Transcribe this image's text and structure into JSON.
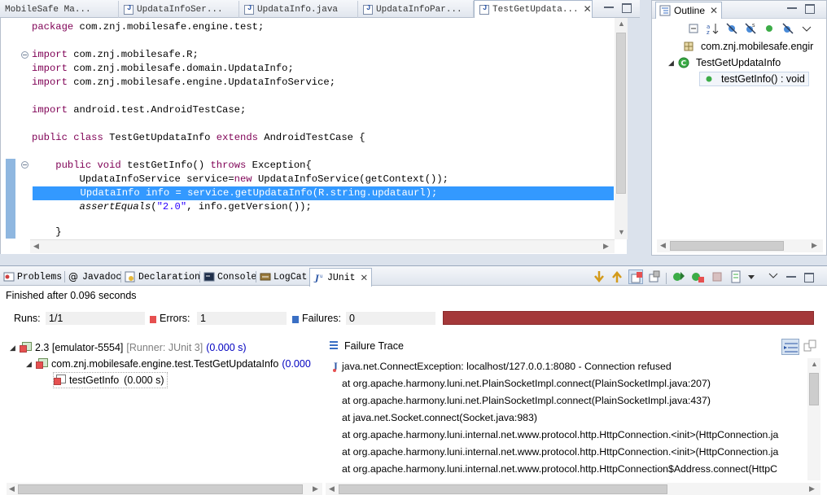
{
  "editor": {
    "tabs": [
      {
        "label": "MobileSafe Ma..."
      },
      {
        "label": "UpdataInfoSer..."
      },
      {
        "label": "UpdataInfo.java"
      },
      {
        "label": "UpdataInfoPar..."
      },
      {
        "label": "TestGetUpdata...",
        "active": true
      }
    ],
    "code_lines": [
      "package com.znj.mobilesafe.engine.test;",
      "import com.znj.mobilesafe.R;",
      "import com.znj.mobilesafe.domain.UpdataInfo;",
      "import com.znj.mobilesafe.engine.UpdataInfoService;",
      "import android.test.AndroidTestCase;",
      "public class TestGetUpdataInfo extends AndroidTestCase {",
      "    public void testGetInfo() throws Exception{",
      "        UpdataInfoService service=new UpdataInfoService(getContext());",
      "        UpdataInfo info = service.getUpdataInfo(R.string.updataurl);",
      "        assertEquals(\"2.0\", info.getVersion());",
      "    }"
    ],
    "highlighted_line_index": 8
  },
  "outline": {
    "tab_label": "Outline",
    "items": [
      {
        "label": "com.znj.mobilesafe.engir",
        "icon": "package-icon"
      },
      {
        "label": "TestGetUpdataInfo",
        "icon": "class-icon"
      },
      {
        "label": "testGetInfo() : void",
        "icon": "public-method-icon"
      }
    ]
  },
  "views": {
    "tabs": [
      {
        "label": "Problems",
        "icon": "problems-icon"
      },
      {
        "label": "Javadoc",
        "icon": "javadoc-icon"
      },
      {
        "label": "Declaration",
        "icon": "declaration-icon"
      },
      {
        "label": "Console",
        "icon": "console-icon"
      },
      {
        "label": "LogCat",
        "icon": "logcat-icon"
      },
      {
        "label": "JUnit",
        "icon": "junit-icon",
        "active": true
      }
    ]
  },
  "junit": {
    "status": "Finished after 0.096 seconds",
    "runs_label": "Runs:",
    "runs_value": "1/1",
    "errors_label": "Errors:",
    "errors_value": "1",
    "failures_label": "Failures:",
    "failures_value": "0",
    "progress_fraction": 1.0,
    "progress_color": "#a4383a",
    "tree": [
      {
        "name": "2.3 [emulator-5554]",
        "runner": "[Runner: JUnit 3]",
        "time": "(0.000 s)"
      },
      {
        "name": "com.znj.mobilesafe.engine.test.TestGetUpdataInfo",
        "time": "(0.000"
      },
      {
        "name": "testGetInfo",
        "time": "(0.000 s)"
      }
    ],
    "failure_trace_label": "Failure Trace",
    "trace": [
      "java.net.ConnectException: localhost/127.0.0.1:8080 - Connection refused",
      "at org.apache.harmony.luni.net.PlainSocketImpl.connect(PlainSocketImpl.java:207)",
      "at org.apache.harmony.luni.net.PlainSocketImpl.connect(PlainSocketImpl.java:437)",
      "at java.net.Socket.connect(Socket.java:983)",
      "at org.apache.harmony.luni.internal.net.www.protocol.http.HttpConnection.<init>(HttpConnection.ja",
      "at org.apache.harmony.luni.internal.net.www.protocol.http.HttpConnection.<init>(HttpConnection.ja",
      "at org.apache.harmony.luni.internal.net.www.protocol.http.HttpConnection$Address.connect(HttpC"
    ]
  }
}
